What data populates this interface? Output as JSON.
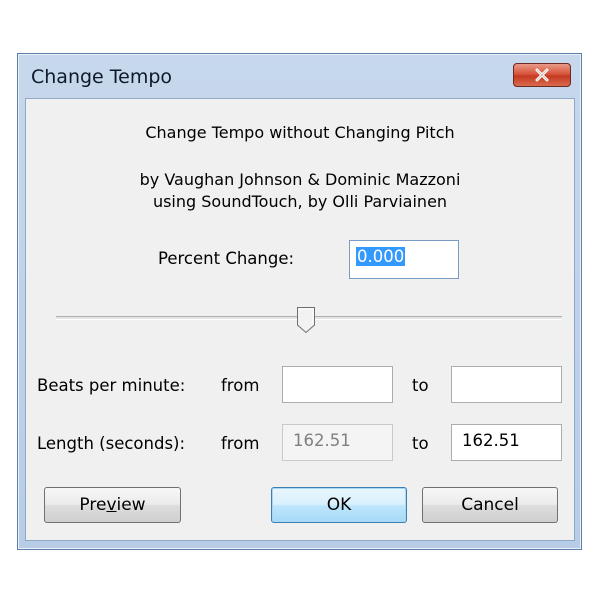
{
  "window": {
    "title": "Change Tempo"
  },
  "header": {
    "line1": "Change Tempo without Changing Pitch",
    "line2": "by Vaughan Johnson & Dominic Mazzoni",
    "line3": "using SoundTouch, by Olli Parviainen"
  },
  "percent": {
    "label": "Percent Change:",
    "value": "0.000"
  },
  "slider": {
    "value_fraction": 0.5
  },
  "bpm": {
    "label": "Beats per minute:",
    "from_label": "from",
    "from_value": "",
    "to_label": "to",
    "to_value": ""
  },
  "length": {
    "label": "Length (seconds):",
    "from_label": "from",
    "from_value": "162.51",
    "to_label": "to",
    "to_value": "162.51"
  },
  "buttons": {
    "preview_pre": "Pre",
    "preview_u": "v",
    "preview_post": "iew",
    "ok": "OK",
    "cancel": "Cancel"
  },
  "icons": {
    "close": "close-x-icon",
    "slider_thumb": "slider-thumb"
  },
  "colors": {
    "selection": "#3399ff",
    "close_button": "#c43a21"
  }
}
